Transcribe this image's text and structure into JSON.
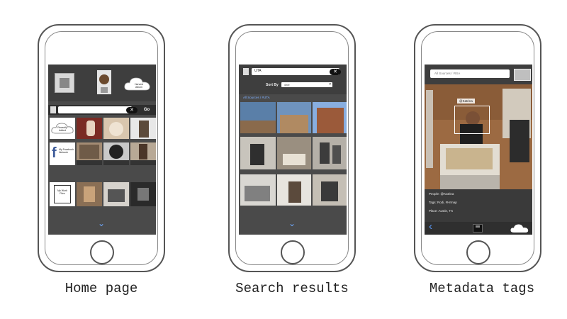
{
  "captions": {
    "home": "Home page",
    "search": "Search results",
    "metadata": "Metadata tags"
  },
  "home_screen": {
    "go_button": "Go",
    "recent_tile_label": "Recently Added",
    "facebook_tile_label": "My Facebook Network",
    "work_tile_label": "My Work Files",
    "cloud_label": "Harvest Album"
  },
  "search_screen": {
    "query": "UTA",
    "sort_label": "Sort By",
    "sort_value": "date",
    "breadcrumb": "All Sources / #UTA"
  },
  "metadata_screen": {
    "search_placeholder": "All Sources / #ISA",
    "face_tag": "@Katrina",
    "people_line": "People: @Katrina",
    "tags_line": "Tags: Rodi, #Hrmap",
    "place_line": "Place: Austin, TX"
  },
  "colors": {
    "screen_bg": "#4a4a4a",
    "accent_blue": "#6fa8ff",
    "link_blue": "#7fb0ff"
  }
}
